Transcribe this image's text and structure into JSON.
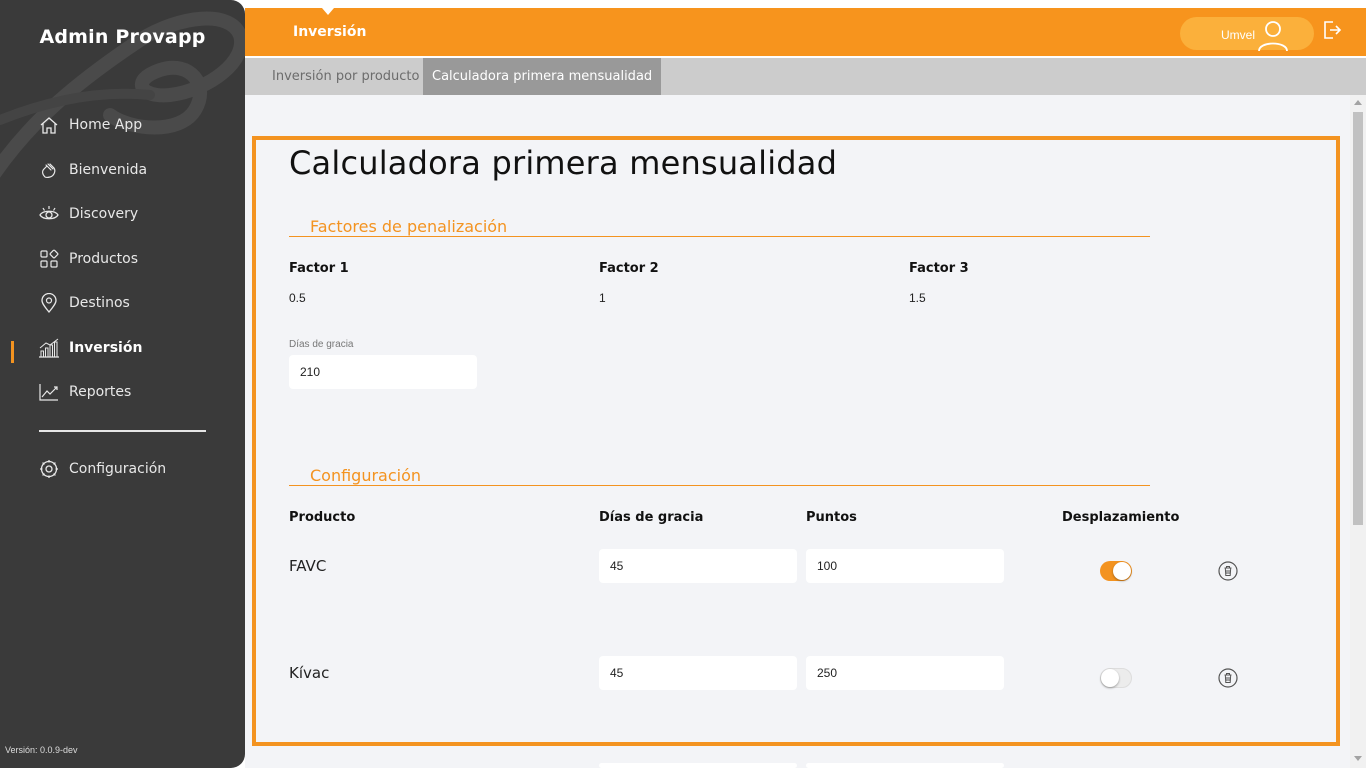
{
  "sidebar": {
    "app_title": "Admin Provapp",
    "items": [
      {
        "label": "Home App",
        "icon": "home-icon"
      },
      {
        "label": "Bienvenida",
        "icon": "wave-hand-icon"
      },
      {
        "label": "Discovery",
        "icon": "eye-icon"
      },
      {
        "label": "Productos",
        "icon": "grid-icon"
      },
      {
        "label": "Destinos",
        "icon": "location-pin-icon"
      },
      {
        "label": "Inversión",
        "icon": "bar-chart-icon",
        "active": true
      },
      {
        "label": "Reportes",
        "icon": "line-chart-icon"
      }
    ],
    "settings_label": "Configuración",
    "version": "Versión: 0.0.9-dev"
  },
  "topbar": {
    "title": "Inversión",
    "user_name": "Umvel"
  },
  "tabs": [
    {
      "label": "Inversión por producto",
      "active": false
    },
    {
      "label": "Calculadora primera mensualidad",
      "active": true
    }
  ],
  "main": {
    "page_title": "Calculadora primera mensualidad",
    "penalties": {
      "section_title": "Factores de penalización",
      "factors": [
        {
          "label": "Factor 1",
          "value": "0.5"
        },
        {
          "label": "Factor 2",
          "value": "1"
        },
        {
          "label": "Factor 3",
          "value": "1.5"
        }
      ],
      "grace_label": "Días de gracia",
      "grace_value": "210"
    },
    "config": {
      "section_title": "Configuración",
      "columns": [
        "Producto",
        "Días de gracia",
        "Puntos",
        "Desplazamiento"
      ],
      "rows": [
        {
          "product": "FAVC",
          "days": "45",
          "points": "100",
          "displacement": true
        },
        {
          "product": "Kívac",
          "days": "45",
          "points": "250",
          "displacement": false
        }
      ]
    }
  },
  "colors": {
    "accent": "#f39320",
    "sidebar_bg": "#3a3a3a",
    "topbar_bg": "#f7941d"
  }
}
